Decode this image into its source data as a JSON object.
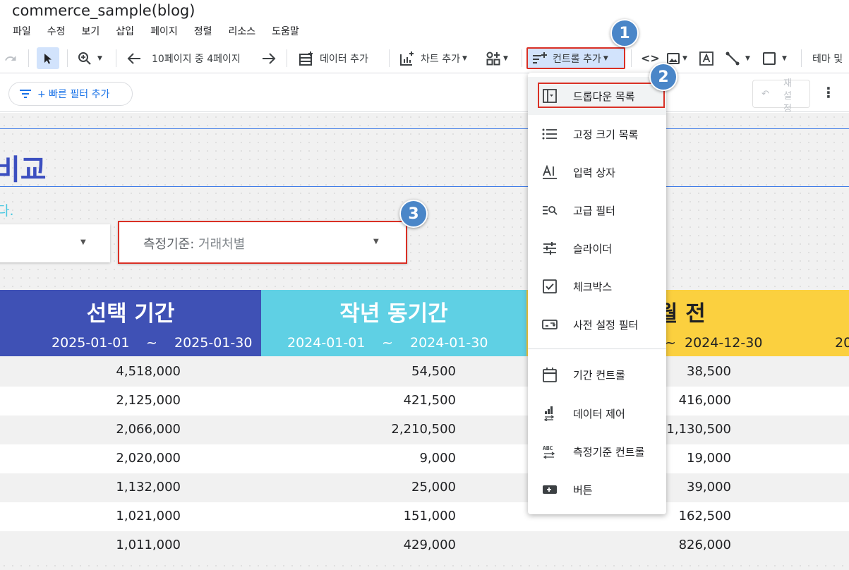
{
  "app": {
    "title": "commerce_sample(blog)"
  },
  "menu": [
    "파일",
    "수정",
    "보기",
    "삽입",
    "페이지",
    "정렬",
    "리소스",
    "도움말"
  ],
  "toolbar": {
    "page_indicator": "10페이지 중 4페이지",
    "add_data": "데이터 추가",
    "add_chart": "차트 추가",
    "add_control": "컨트롤 추가",
    "theme_layout": "테마 및"
  },
  "filter_bar": {
    "quick_filter": "+ 빠른 필터 추가",
    "reset": "재설정"
  },
  "canvas": {
    "heading": "비교",
    "description": "다.",
    "metric_dropdown": {
      "label": "측정기준:",
      "value": "거래처별"
    }
  },
  "table": {
    "headers": [
      {
        "title": "선택 기간",
        "start": "2025-01-01",
        "sep": "~",
        "end": "2025-01-30"
      },
      {
        "title": "작년 동기간",
        "start": "2024-01-01",
        "sep": "~",
        "end": "2024-01-30"
      },
      {
        "title": "월 전",
        "sep": "~",
        "end": "2024-12-30",
        "extra": "20"
      }
    ],
    "rows": [
      [
        "4,518,000",
        "54,500",
        "38,500"
      ],
      [
        "2,125,000",
        "421,500",
        "416,000"
      ],
      [
        "2,066,000",
        "2,210,500",
        "1,130,500"
      ],
      [
        "2,020,000",
        "9,000",
        "19,000"
      ],
      [
        "1,132,000",
        "25,000",
        "39,000"
      ],
      [
        "1,021,000",
        "151,000",
        "162,500"
      ],
      [
        "1,011,000",
        "429,000",
        "826,000"
      ]
    ]
  },
  "control_menu": {
    "items": [
      {
        "label": "드롭다운 목록",
        "icon": "dropdown-list-icon"
      },
      {
        "label": "고정 크기 목록",
        "icon": "fixed-list-icon"
      },
      {
        "label": "입력 상자",
        "icon": "input-box-icon"
      },
      {
        "label": "고급 필터",
        "icon": "advanced-filter-icon"
      },
      {
        "label": "슬라이더",
        "icon": "slider-icon"
      },
      {
        "label": "체크박스",
        "icon": "checkbox-icon"
      },
      {
        "label": "사전 설정 필터",
        "icon": "preset-filter-icon"
      },
      {
        "label": "기간 컨트롤",
        "icon": "date-range-icon"
      },
      {
        "label": "데이터 제어",
        "icon": "data-control-icon"
      },
      {
        "label": "측정기준 컨트롤",
        "icon": "dimension-control-icon"
      },
      {
        "label": "버튼",
        "icon": "button-icon"
      }
    ]
  },
  "badges": [
    "1",
    "2",
    "3"
  ],
  "colors": {
    "header_1": "#3f51b5",
    "header_2": "#5fd0e4",
    "header_3": "#fbd03f",
    "highlight": "#d93025",
    "badge": "#4a86c8"
  }
}
